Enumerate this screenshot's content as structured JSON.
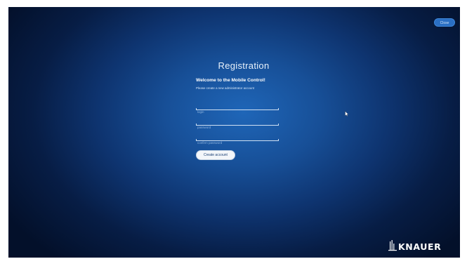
{
  "header": {
    "close_label": "Close"
  },
  "form": {
    "title": "Registration",
    "welcome": "Welcome to the Mobile Control!",
    "subtitle": "Please create a new administrator account",
    "login_placeholder": "login",
    "password_placeholder": "password",
    "confirm_placeholder": "confirm password",
    "submit_label": "Create account"
  },
  "brand": {
    "name": "KNAUER"
  },
  "colors": {
    "background_center": "#1f66b8",
    "background_edge": "#03102a",
    "button_light": "#f3f6fa",
    "close_button": "#2a6fc4"
  }
}
